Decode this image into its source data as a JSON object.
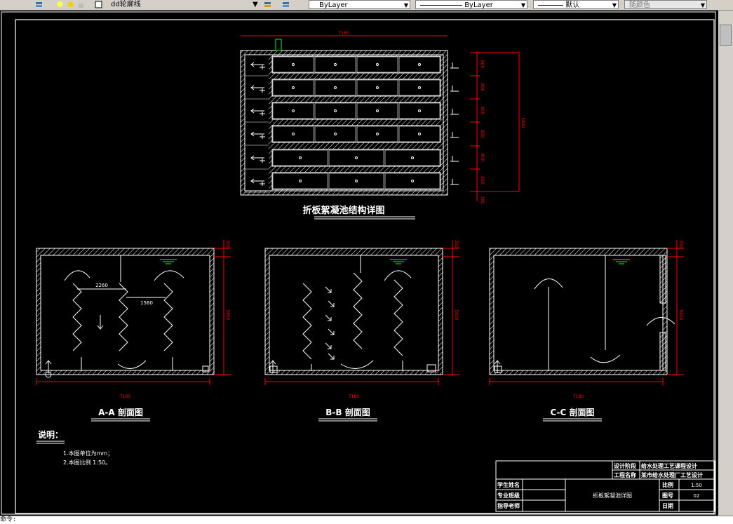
{
  "toolbar": {
    "layer_name": "dd轮廓线",
    "color": "ByLayer",
    "linetype": "ByLayer",
    "lineweight": "默认",
    "plotstyle": "随颜色"
  },
  "drawing": {
    "plan_title": "折板絮凝池结构详图",
    "plan_dim_top": "7180",
    "plan_dim_right_total": "5800",
    "plan_dim_row": "800",
    "plan_dim_bottom": "300",
    "sections": [
      {
        "title": "A-A 剖面图",
        "width_dim": "7180",
        "height_dim": "5800",
        "top_dim": "300",
        "dim_a": "2260",
        "dim_b": "1560"
      },
      {
        "title": "B-B 剖面图",
        "width_dim": "7180",
        "height_dim": "5800",
        "top_dim": "300"
      },
      {
        "title": "C-C 剖面图",
        "width_dim": "7180",
        "height_dim": "5800",
        "top_dim": "300"
      }
    ],
    "notes_title": "说明：",
    "notes": [
      "1.本图单位为mm；",
      "2.本图比例 1:50。"
    ],
    "title_block": {
      "design_label": "设计阶段",
      "design_value": "给水处理工艺课程设计",
      "project_label": "工程名称",
      "project_value": "某市给水处理厂工艺设计",
      "student_label": "学生姓名",
      "class_label": "专业班级",
      "teacher_label": "指导老师",
      "drawing_name": "折板絮凝池详图",
      "scale_label": "比例",
      "scale_value": "1:50",
      "sheet_label": "图号",
      "sheet_value": "02",
      "date_label": "日期"
    }
  },
  "cmdline": {
    "text": "命令:"
  }
}
